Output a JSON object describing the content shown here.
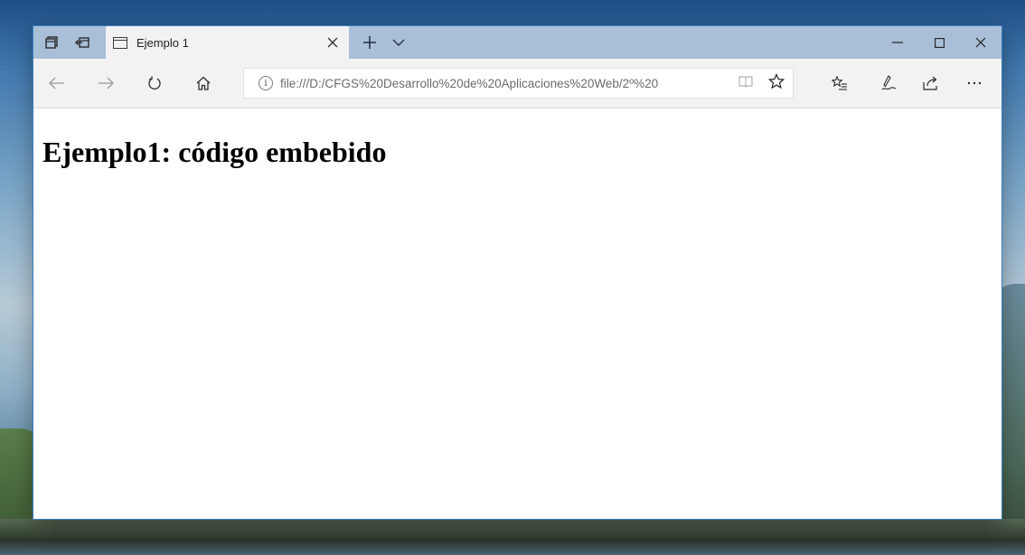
{
  "browser": {
    "tab": {
      "title": "Ejemplo 1"
    },
    "address_bar": {
      "url": "file:///D:/CFGS%20Desarrollo%20de%20Aplicaciones%20Web/2º%20"
    }
  },
  "page": {
    "heading": "Ejemplo1: código embebido"
  },
  "icons": {
    "tab_manager": "tab-manager-icon",
    "set_aside": "set-aside-tabs-icon",
    "page": "page-icon",
    "close_tab": "close-icon",
    "new_tab": "plus-icon",
    "tab_menu": "chevron-down-icon",
    "minimize": "minimize-icon",
    "maximize": "maximize-icon",
    "close_window": "close-icon",
    "back": "back-arrow-icon",
    "forward": "forward-arrow-icon",
    "refresh": "refresh-icon",
    "home": "home-icon",
    "site_info": "info-icon",
    "reading_view": "reading-view-icon",
    "favorite": "star-icon",
    "favorites_hub": "favorites-hub-icon",
    "web_note": "web-note-icon",
    "share": "share-icon",
    "more": "more-icon"
  },
  "colors": {
    "title_bar": "#a9bfd7",
    "nav_bar": "#f2f2f2",
    "active_tab": "#f2f2f2",
    "window_border": "#3a7fc0"
  }
}
